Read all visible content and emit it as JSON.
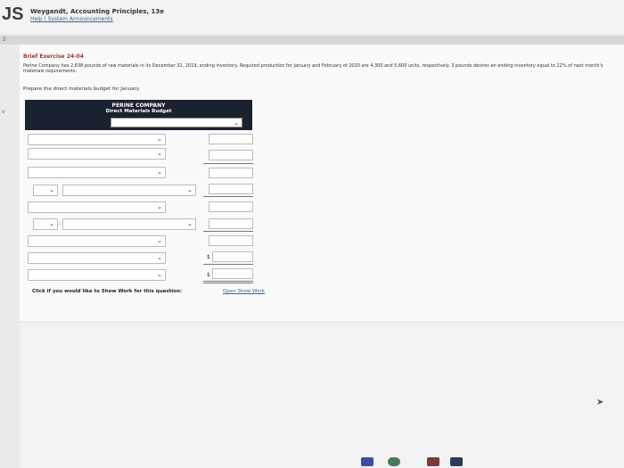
{
  "header": {
    "logo": "JS",
    "book_title": "Weygandt, Accounting Principles, 13e",
    "help": "Help",
    "separator": "|",
    "announcements": "System Announcements"
  },
  "side": {
    "bar_mark": "5",
    "side_mark": "v"
  },
  "exercise": {
    "title": "Brief Exercise 24-04",
    "text": "Perine Company has 2,838 pounds of raw materials in its December 31, 2019, ending inventory. Required production for January and February of 2020 are 4,300 and 5,600 units, respectively. 3 pounds desires an ending inventory equal to 22% of next month's materials requirements.",
    "prompt": "Prepare the direct materials budget for January."
  },
  "table": {
    "company": "PERINE COMPANY",
    "subtitle": "Direct Materials Budget",
    "dollar": "$"
  },
  "show_work": {
    "text": "Click if you would like to Show Work for this question:",
    "link": "Open Show Work"
  },
  "colors": {
    "header_bg": "#1a2230",
    "link": "#3a62a8",
    "exercise_title": "#aa3333"
  }
}
